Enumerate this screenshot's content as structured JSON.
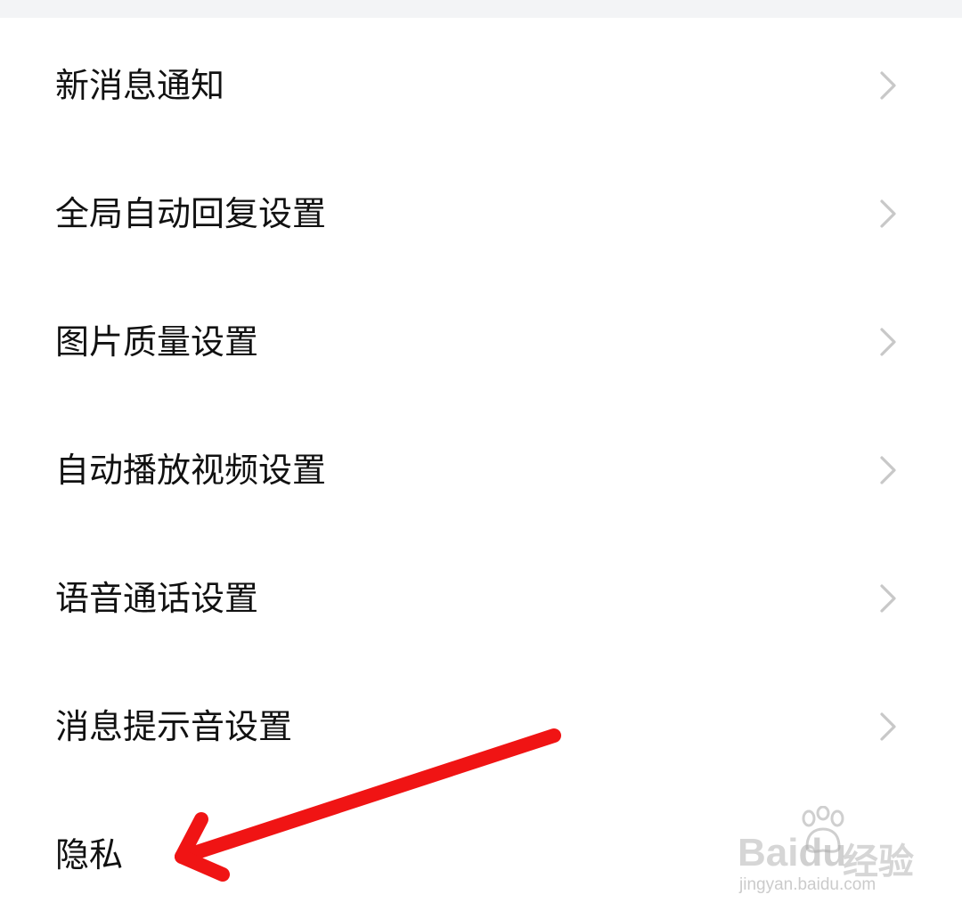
{
  "settings": {
    "items": [
      {
        "label": "新消息通知"
      },
      {
        "label": "全局自动回复设置"
      },
      {
        "label": "图片质量设置"
      },
      {
        "label": "自动播放视频设置"
      },
      {
        "label": "语音通话设置"
      },
      {
        "label": "消息提示音设置"
      },
      {
        "label": "隐私"
      }
    ]
  },
  "icons": {
    "chevron": "chevron-right-icon",
    "arrow": "red-annotation-arrow"
  },
  "colors": {
    "background": "#ffffff",
    "top_band": "#f3f4f6",
    "text": "#111111",
    "chevron": "#c8c8c8",
    "annotation_arrow": "#f01414"
  },
  "watermark": {
    "brand_bai": "Bai",
    "brand_du": "du",
    "brand_jingyan": "经验",
    "url": "jingyan.baidu.com"
  }
}
